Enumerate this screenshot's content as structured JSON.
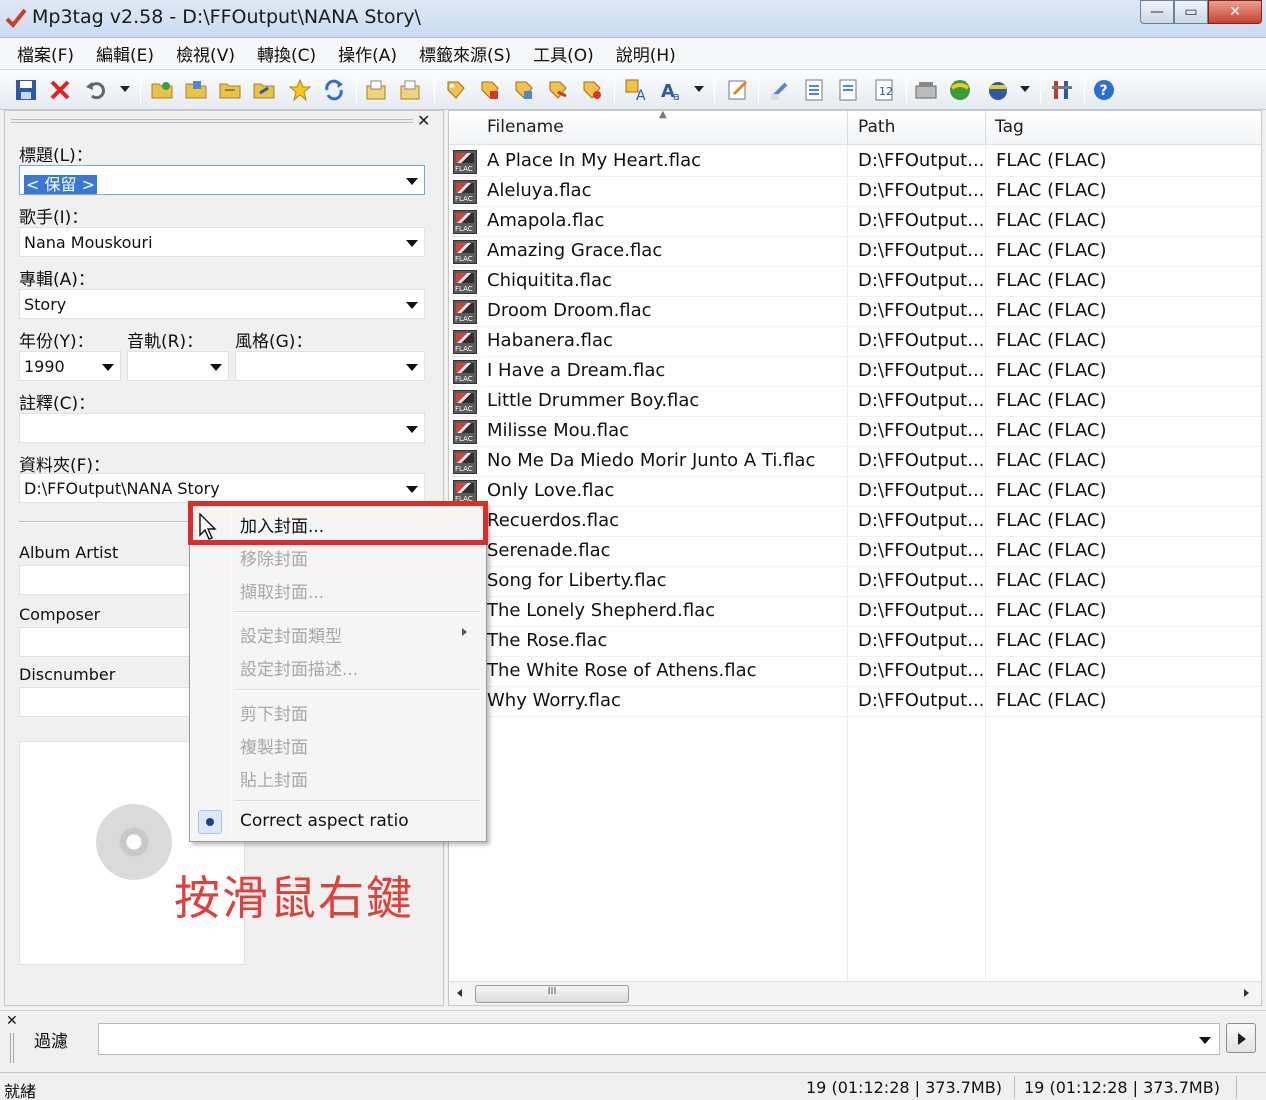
{
  "window": {
    "title": "Mp3tag v2.58  -  D:\\FFOutput\\NANA Story\\",
    "controls": {
      "minimize": "—",
      "maximize": "▭",
      "close": "✕"
    }
  },
  "menu": [
    "檔案(F)",
    "編輯(E)",
    "檢視(V)",
    "轉換(C)",
    "操作(A)",
    "標籤來源(S)",
    "工具(O)",
    "說明(H)"
  ],
  "tag_panel": {
    "close_glyph": "✕",
    "title_label": "標題(L)：",
    "title_value": "< 保留 >",
    "artist_label": "歌手(I)：",
    "artist_value": "Nana Mouskouri",
    "album_label": "專輯(A)：",
    "album_value": "Story",
    "year_label": "年份(Y)：",
    "year_value": "1990",
    "track_label": "音軌(R)：",
    "track_value": "",
    "genre_label": "風格(G)：",
    "genre_value": "",
    "comment_label": "註釋(C)：",
    "comment_value": "",
    "directory_label": "資料夾(F)：",
    "directory_value": "D:\\FFOutput\\NANA Story",
    "album_artist_label": "Album Artist",
    "composer_label": "Composer",
    "discnumber_label": "Discnumber"
  },
  "file_list": {
    "columns": [
      "Filename",
      "Path",
      "Tag"
    ],
    "rows": [
      [
        "A Place In My Heart.flac",
        "D:\\FFOutput...",
        "FLAC (FLAC)"
      ],
      [
        "Aleluya.flac",
        "D:\\FFOutput...",
        "FLAC (FLAC)"
      ],
      [
        "Amapola.flac",
        "D:\\FFOutput...",
        "FLAC (FLAC)"
      ],
      [
        "Amazing Grace.flac",
        "D:\\FFOutput...",
        "FLAC (FLAC)"
      ],
      [
        "Chiquitita.flac",
        "D:\\FFOutput...",
        "FLAC (FLAC)"
      ],
      [
        "Droom Droom.flac",
        "D:\\FFOutput...",
        "FLAC (FLAC)"
      ],
      [
        "Habanera.flac",
        "D:\\FFOutput...",
        "FLAC (FLAC)"
      ],
      [
        "I Have a Dream.flac",
        "D:\\FFOutput...",
        "FLAC (FLAC)"
      ],
      [
        "Little Drummer Boy.flac",
        "D:\\FFOutput...",
        "FLAC (FLAC)"
      ],
      [
        "Milisse Mou.flac",
        "D:\\FFOutput...",
        "FLAC (FLAC)"
      ],
      [
        "No Me Da Miedo Morir Junto A Ti.flac",
        "D:\\FFOutput...",
        "FLAC (FLAC)"
      ],
      [
        "Only Love.flac",
        "D:\\FFOutput...",
        "FLAC (FLAC)"
      ],
      [
        "Recuerdos.flac",
        "D:\\FFOutput...",
        "FLAC (FLAC)"
      ],
      [
        "Serenade.flac",
        "D:\\FFOutput...",
        "FLAC (FLAC)"
      ],
      [
        "Song for Liberty.flac",
        "D:\\FFOutput...",
        "FLAC (FLAC)"
      ],
      [
        "The Lonely Shepherd.flac",
        "D:\\FFOutput...",
        "FLAC (FLAC)"
      ],
      [
        "The Rose.flac",
        "D:\\FFOutput...",
        "FLAC (FLAC)"
      ],
      [
        "The White Rose of Athens.flac",
        "D:\\FFOutput...",
        "FLAC (FLAC)"
      ],
      [
        "Why Worry.flac",
        "D:\\FFOutput...",
        "FLAC (FLAC)"
      ]
    ],
    "scroll_thumb": "III"
  },
  "context_menu": {
    "add_cover": "加入封面...",
    "remove_cover": "移除封面",
    "extract_cover": "擷取封面...",
    "set_cover_type": "設定封面類型",
    "set_cover_description": "設定封面描述...",
    "cut_cover": "剪下封面",
    "copy_cover": "複製封面",
    "paste_cover": "貼上封面",
    "correct_aspect_ratio": "Correct aspect ratio"
  },
  "annotation": "按滑鼠右鍵",
  "filter": {
    "close_glyph": "✕",
    "label": "過濾",
    "value": ""
  },
  "status": {
    "ready": "就緒",
    "selected": "19 (01:12:28 | 373.7MB)",
    "total": "19 (01:12:28 | 373.7MB)"
  },
  "colors": {
    "highlight": "#e02b27",
    "annotation": "#e0403a",
    "selection": "#3a78d6"
  },
  "icons": [
    "app-checkmark-icon",
    "save-icon",
    "delete-icon",
    "undo-icon",
    "open-folder-icon",
    "star-icon",
    "refresh-icon",
    "export-icon",
    "tag-source-icon",
    "case-conversion-icon",
    "edit-icon",
    "web-source-icon",
    "tools-icon",
    "help-icon",
    "cover-placeholder-disc-icon",
    "mouse-cursor-icon",
    "flac-file-icon"
  ]
}
